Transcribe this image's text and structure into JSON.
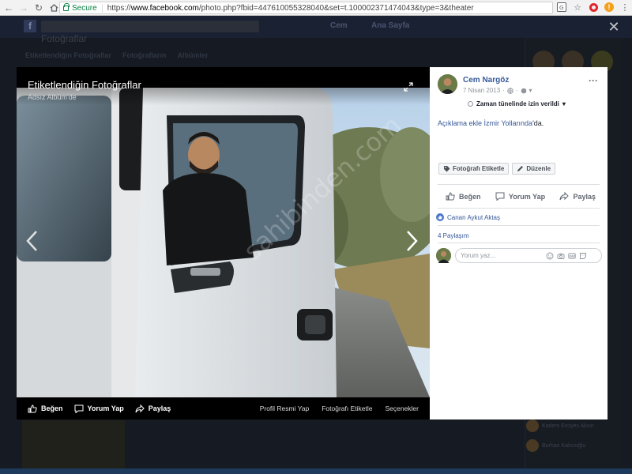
{
  "browser": {
    "secure_label": "Secure",
    "url_scheme": "https://",
    "url_host": "www.facebook.com",
    "url_path": "/photo.php?fbid=447610055328040&set=t.100002371474043&type=3&theater"
  },
  "facebook_bg": {
    "logo": "f",
    "profile_name": "Cem",
    "home_label": "Ana Sayfa",
    "section_title": "Fotoğraflar",
    "tabs": [
      "Etiketlendiğin Fotoğraflar",
      "Fotoğrafların",
      "Albümler"
    ],
    "friends": [
      "Kadem Erciyes Akcin",
      "Burhan Kalıcıoğlu"
    ]
  },
  "viewer": {
    "title": "Etiketlendiğin Fotoğraflar",
    "album": "Adsız Albüm'de",
    "watermark": "sahibinden.com",
    "bottom_left": {
      "like": "Beğen",
      "comment": "Yorum Yap",
      "share": "Paylaş"
    },
    "bottom_right": [
      "Profil Resmi Yap",
      "Fotoğrafı Etiketle",
      "Seçenekler"
    ]
  },
  "panel": {
    "author": "Cem Nargöz",
    "date": "7 Nisan 2013",
    "privacy": "Zaman tünelinde izin verildi",
    "caption_prefix": "Açıklama ekle ",
    "caption_link": "İzmir Yollarında",
    "caption_suffix": "'da.",
    "tag_button": "Fotoğrafı Etiketle",
    "edit_button": "Düzenle",
    "like": "Beğen",
    "comment": "Yorum Yap",
    "share": "Paylaş",
    "liked_by": "Canan Aykut Aktaş",
    "shares": "4 Paylaşım",
    "comment_placeholder": "Yorum yaz..."
  },
  "colors": {
    "facebook_blue": "#365899",
    "like_blue": "#4a76c9"
  },
  "icons": [
    "back-icon",
    "forward-icon",
    "reload-icon",
    "home-icon",
    "lock-icon",
    "translate-icon",
    "star-icon",
    "opera-icon",
    "warning-icon",
    "close-icon",
    "expand-icon",
    "chevron-left-icon",
    "chevron-right-icon",
    "like-icon",
    "comment-icon",
    "share-icon",
    "tag-icon",
    "pencil-icon",
    "globe-icon",
    "emoji-icon",
    "camera-icon",
    "gif-icon",
    "sticker-icon"
  ]
}
